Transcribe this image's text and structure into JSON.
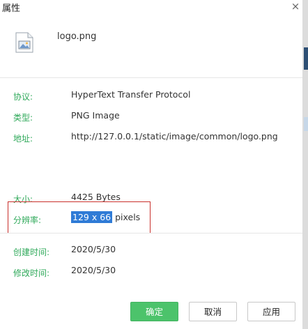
{
  "window": {
    "title": "属性",
    "close_symbol": "×"
  },
  "file": {
    "name": "logo.png",
    "icon": "image-file-icon"
  },
  "properties": {
    "protocol": {
      "label": "协议:",
      "value": "HyperText Transfer Protocol"
    },
    "type": {
      "label": "类型:",
      "value": "PNG Image"
    },
    "address": {
      "label": "地址:",
      "value": "http://127.0.0.1/static/image/common/logo.png"
    },
    "size": {
      "label": "大小:",
      "value": "4425 Bytes"
    },
    "resolution": {
      "label": "分辨率:",
      "value_selected": "129 x 66",
      "value_suffix": " pixels"
    },
    "created": {
      "label": "创建时间:",
      "value": "2020/5/30"
    },
    "modified": {
      "label": "修改时间:",
      "value": "2020/5/30"
    }
  },
  "buttons": {
    "ok": "确定",
    "cancel": "取消",
    "apply": "应用"
  },
  "colors": {
    "label_green": "#2fa95a",
    "ok_green": "#4cc36b",
    "selection_blue": "#2f7bd6",
    "highlight_box_red": "#c9302c"
  }
}
